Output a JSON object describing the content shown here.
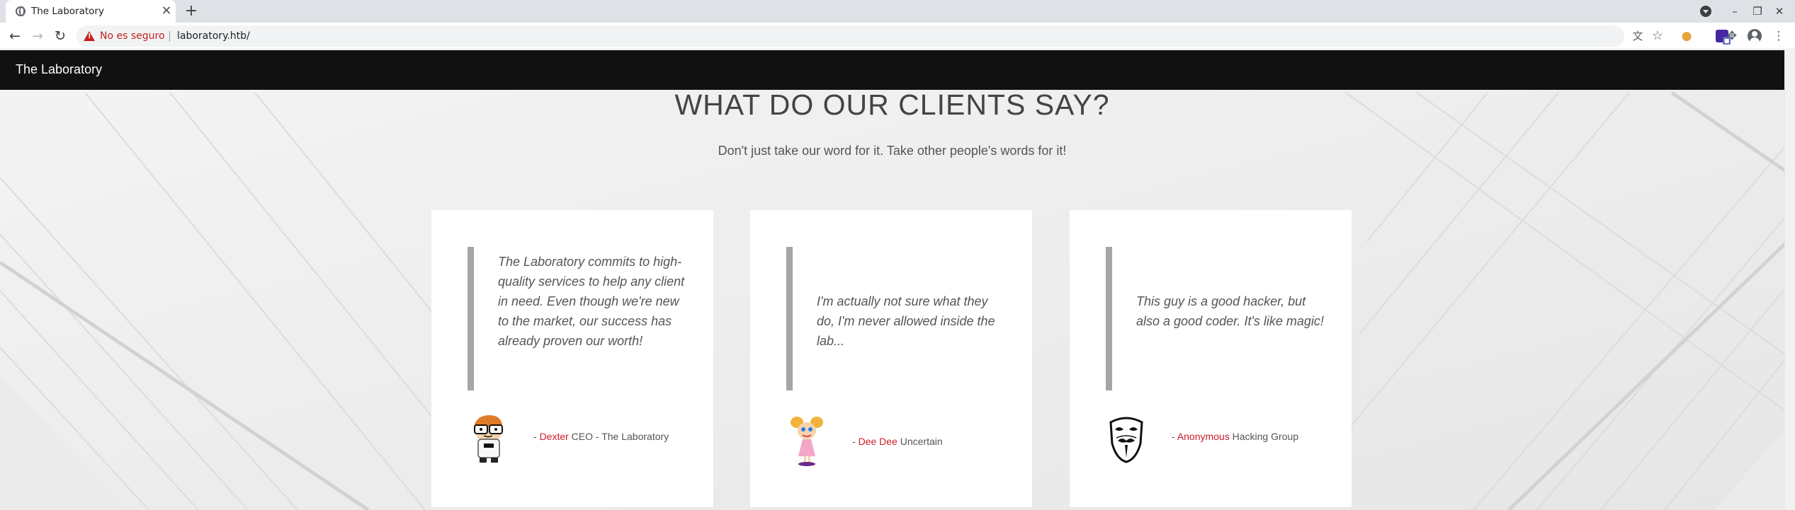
{
  "browser": {
    "tab_title": "The Laboratory",
    "tab_close": "×",
    "new_tab": "+",
    "security_label": "No es seguro",
    "url": "laboratory.htb/",
    "back": "←",
    "forward": "→",
    "reload": "↻",
    "minimize": "–",
    "restore": "❐",
    "close_window": "✕",
    "translate_icon": "文",
    "bookmark_icon": "☆",
    "cookie_icon": "●",
    "puzzle_icon": "✥",
    "menu_icon": "⋮"
  },
  "site": {
    "brand": "The Laboratory"
  },
  "section": {
    "title": "WHAT DO OUR CLIENTS SAY?",
    "subtitle": "Don't just take our word for it. Take other people's words for it!"
  },
  "testimonials": [
    {
      "quote": "The Laboratory commits to high-quality services to help any client in need. Even though we're new to the market, our success has already proven our worth!",
      "dash": "- ",
      "name": "Dexter",
      "role": " CEO - The Laboratory",
      "avatar": "dexter"
    },
    {
      "quote": "I'm actually not sure what they do, I'm never allowed inside the lab...",
      "dash": "- ",
      "name": "Dee Dee",
      "role": " Uncertain",
      "avatar": "dee-dee"
    },
    {
      "quote": "This guy is a good hacker, but also a good coder. It's like magic!",
      "dash": "- ",
      "name": "Anonymous",
      "role": " Hacking Group",
      "avatar": "anonymous-mask"
    }
  ],
  "colors": {
    "nav_bg": "#111111",
    "author_accent": "#cc1c2b",
    "quote_bar": "#a6a6a6",
    "insecure_red": "#c5221f"
  }
}
